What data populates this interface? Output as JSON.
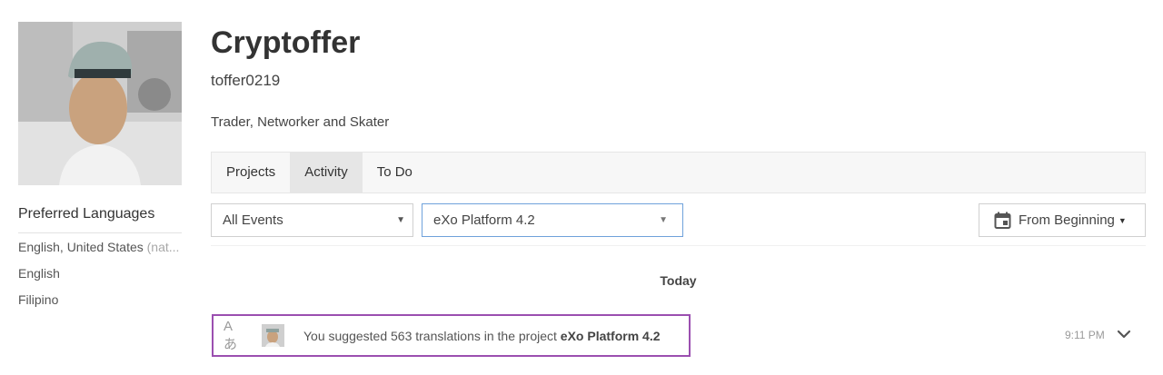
{
  "profile": {
    "name": "Cryptoffer",
    "username": "toffer0219",
    "bio": "Trader, Networker and Skater"
  },
  "languages": {
    "title": "Preferred Languages",
    "items": [
      {
        "label": "English, United States",
        "suffix": "(nat..."
      },
      {
        "label": "English",
        "suffix": ""
      },
      {
        "label": "Filipino",
        "suffix": ""
      }
    ]
  },
  "tabs": [
    {
      "label": "Projects",
      "active": false
    },
    {
      "label": "Activity",
      "active": true
    },
    {
      "label": "To Do",
      "active": false
    }
  ],
  "filters": {
    "events": "All Events",
    "project": "eXo Platform 4.2",
    "date": "From Beginning"
  },
  "feed": {
    "day": "Today",
    "items": [
      {
        "text_prefix": "You suggested 563 translations in the project ",
        "project": "eXo Platform 4.2",
        "time": "9:11 PM",
        "icon": "translate-icon"
      }
    ]
  },
  "colors": {
    "highlight_border": "#9b4fb0",
    "focus_border": "#6fa2db",
    "active_tab": "#e6e6e6"
  }
}
